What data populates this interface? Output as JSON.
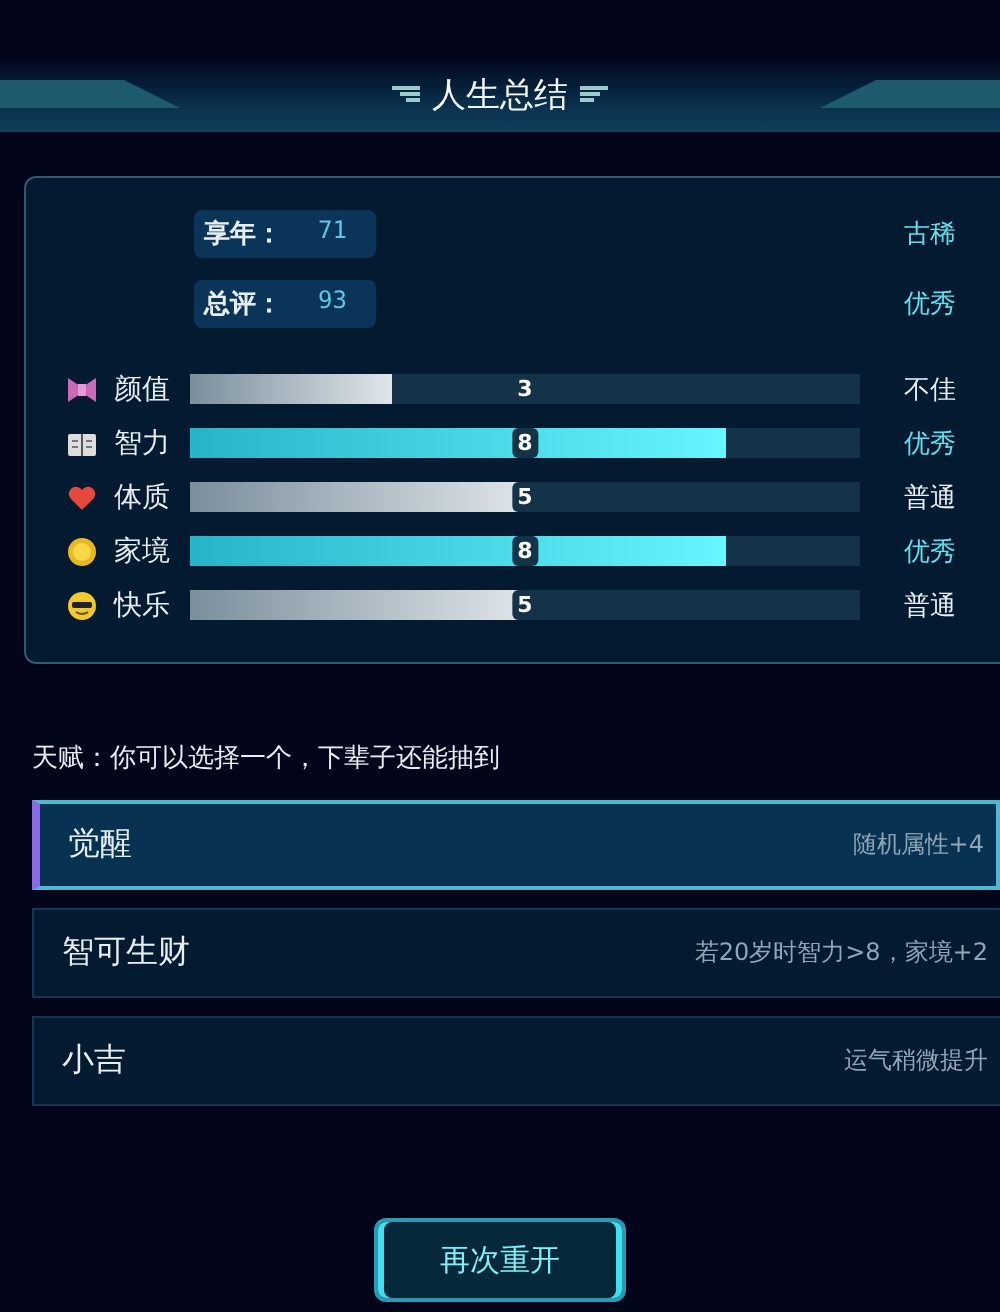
{
  "title": "人生总结",
  "summary": [
    {
      "label": "享年：",
      "value": "71",
      "grade": "古稀"
    },
    {
      "label": "总评：",
      "value": "93",
      "grade": "优秀"
    }
  ],
  "stats": [
    {
      "kind": "bow",
      "name": "颜值",
      "level": 0.3,
      "value": "3",
      "grade": "不佳",
      "highlighted": false
    },
    {
      "kind": "book",
      "name": "智力",
      "level": 0.8,
      "value": "8",
      "grade": "优秀",
      "highlighted": true
    },
    {
      "kind": "heart",
      "name": "体质",
      "level": 0.5,
      "value": "5",
      "grade": "普通",
      "highlighted": false
    },
    {
      "kind": "coin",
      "name": "家境",
      "level": 0.8,
      "value": "8",
      "grade": "优秀",
      "highlighted": true
    },
    {
      "kind": "face",
      "name": "快乐",
      "level": 0.5,
      "value": "5",
      "grade": "普通",
      "highlighted": false
    }
  ],
  "talent_prompt": "天赋：你可以选择一个，下辈子还能抽到",
  "talents": [
    {
      "name": "觉醒",
      "effect": "随机属性+4",
      "selected": true
    },
    {
      "name": "智可生财",
      "effect": "若20岁时智力>8，家境+2",
      "selected": false
    },
    {
      "name": "小吉",
      "effect": "运气稍微提升",
      "selected": false
    }
  ],
  "restart_button": "再次重开"
}
